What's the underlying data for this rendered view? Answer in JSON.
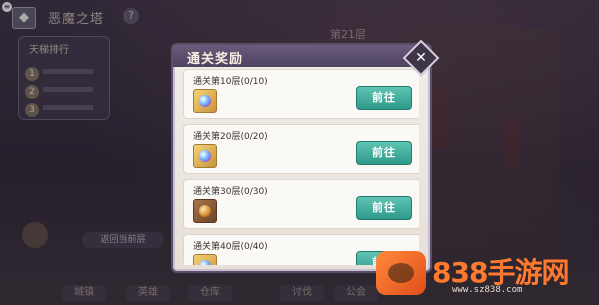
{
  "background": {
    "corner_mark": "≡",
    "back_icon": "back-icon",
    "back_glyph": "◆",
    "tower_title": "恶魔之塔",
    "help_glyph": "?",
    "rank_title": "天梯排行",
    "rank_numbers": [
      "1",
      "2",
      "3"
    ],
    "floor_label": "第21层",
    "return_button": "返回当前层",
    "nav_items": [
      "城镇",
      "英雄",
      "仓库",
      "讨伐",
      "公会"
    ]
  },
  "modal": {
    "title": "通关奖励",
    "close_glyph": "✕",
    "items": [
      {
        "label": "通关第10层(0/10)",
        "button": "前往",
        "icon": "gem-chest-icon"
      },
      {
        "label": "通关第20层(0/20)",
        "button": "前往",
        "icon": "gem-chest-icon"
      },
      {
        "label": "通关第30层(0/30)",
        "button": "前往",
        "icon": "treasure-chest-icon"
      },
      {
        "label": "通关第40层(0/40)",
        "button": "前往",
        "icon": "gem-chest-icon"
      }
    ]
  },
  "watermark": {
    "text": "838手游网",
    "url": "www.sz838.com"
  },
  "colors": {
    "accent": "#2f9a8a",
    "header": "#4d4260",
    "watermark": "#ff7a2e"
  }
}
